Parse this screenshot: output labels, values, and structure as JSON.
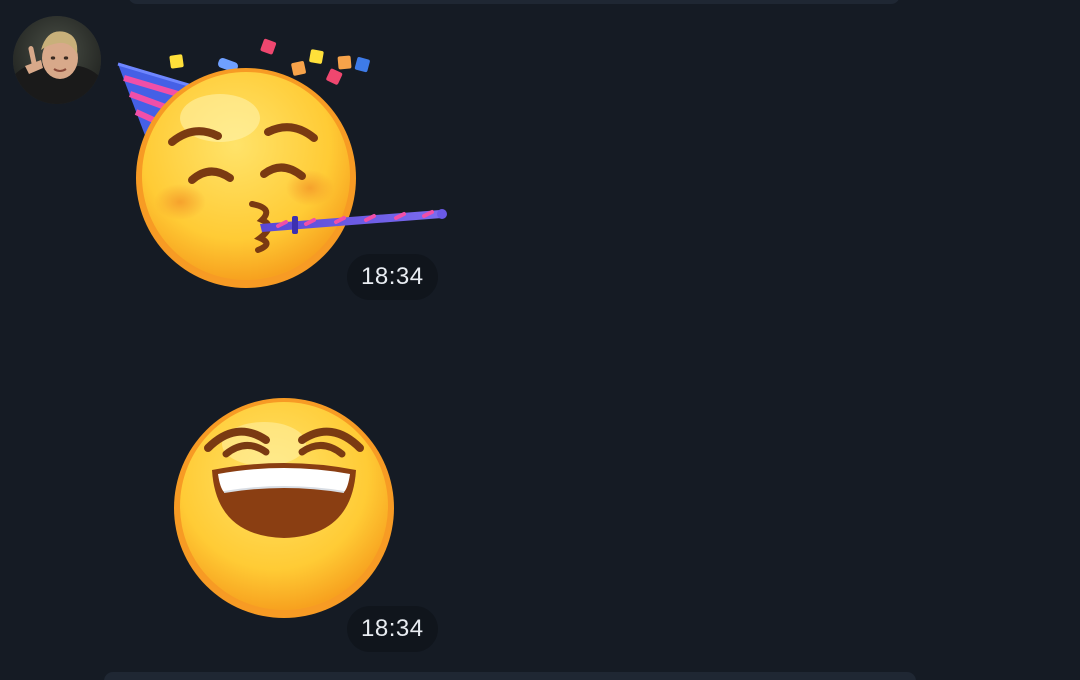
{
  "theme": {
    "background": "#151b24",
    "badge_background": "#10151c",
    "badge_text": "#e8ecf1",
    "emoji_yellow": "#ffd23f",
    "emoji_orange": "#f5a623",
    "emoji_brown": "#7a3a12"
  },
  "sender": {
    "avatar_icon": "user-avatar-photo"
  },
  "messages": [
    {
      "type": "sticker",
      "sticker_icon": "partying-face-emoji",
      "time": "18:34"
    },
    {
      "type": "sticker",
      "sticker_icon": "grinning-laughing-face-emoji",
      "time": "18:34"
    }
  ]
}
